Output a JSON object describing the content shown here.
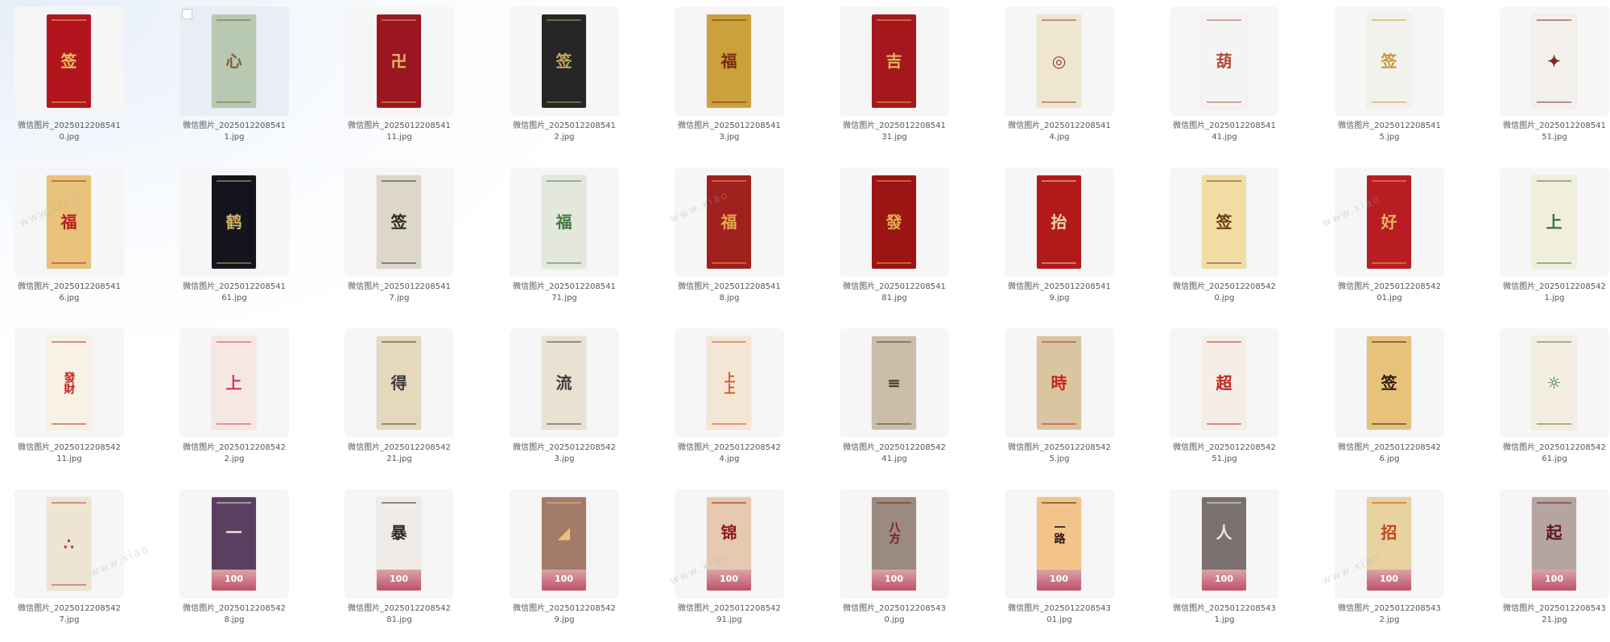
{
  "files": [
    {
      "name": "微信图片_20250122085410.jpg",
      "theme": {
        "bg": "#b3151e",
        "fg": "#e8c060",
        "motif": "签"
      }
    },
    {
      "name": "微信图片_20250122085411.jpg",
      "theme": {
        "bg": "#b7c9b0",
        "fg": "#8a5a3a",
        "motif": "心"
      },
      "selected": true
    },
    {
      "name": "微信图片_202501220854111.jpg",
      "theme": {
        "bg": "#9b1620",
        "fg": "#e0b86a",
        "motif": "卍"
      }
    },
    {
      "name": "微信图片_20250122085412.jpg",
      "theme": {
        "bg": "#262626",
        "fg": "#c8a85a",
        "motif": "签"
      }
    },
    {
      "name": "微信图片_20250122085413.jpg",
      "theme": {
        "bg": "#caa13a",
        "fg": "#7a2a10",
        "motif": "福"
      }
    },
    {
      "name": "微信图片_202501220854131.jpg",
      "theme": {
        "bg": "#a5171c",
        "fg": "#e6b660",
        "motif": "吉"
      }
    },
    {
      "name": "微信图片_20250122085414.jpg",
      "theme": {
        "bg": "#efe6d2",
        "fg": "#9a3a2a",
        "motif": "◎"
      }
    },
    {
      "name": "微信图片_202501220854141.jpg",
      "theme": {
        "bg": "#f4f4f4",
        "fg": "#b24a3a",
        "motif": "葫"
      }
    },
    {
      "name": "微信图片_20250122085415.jpg",
      "theme": {
        "bg": "#f2f2ec",
        "fg": "#c59a3a",
        "motif": "签"
      }
    },
    {
      "name": "微信图片_202501220854151.jpg",
      "theme": {
        "bg": "#f3efeb",
        "fg": "#7a2a2a",
        "motif": "✦"
      }
    },
    {
      "name": "微信图片_20250122085416.jpg",
      "theme": {
        "bg": "#e8c27a",
        "fg": "#b01e1e",
        "motif": "福"
      }
    },
    {
      "name": "微信图片_202501220854161.jpg",
      "theme": {
        "bg": "#14141c",
        "fg": "#d6b265",
        "motif": "鹤"
      }
    },
    {
      "name": "微信图片_20250122085417.jpg",
      "theme": {
        "bg": "#ddd7c9",
        "fg": "#2a2a2a",
        "motif": "签"
      }
    },
    {
      "name": "微信图片_202501220854171.jpg",
      "theme": {
        "bg": "#e4e8dc",
        "fg": "#3f7a3f",
        "motif": "福"
      }
    },
    {
      "name": "微信图片_20250122085418.jpg",
      "theme": {
        "bg": "#a0201e",
        "fg": "#e2ad4a",
        "motif": "福"
      }
    },
    {
      "name": "微信图片_202501220854181.jpg",
      "theme": {
        "bg": "#9c1414",
        "fg": "#e2b04f",
        "motif": "發"
      }
    },
    {
      "name": "微信图片_20250122085419.jpg",
      "theme": {
        "bg": "#b2191b",
        "fg": "#f1d7a0",
        "motif": "抬"
      }
    },
    {
      "name": "微信图片_20250122085420.jpg",
      "theme": {
        "bg": "#f1dca4",
        "fg": "#6a3a10",
        "motif": "签"
      }
    },
    {
      "name": "微信图片_202501220854201.jpg",
      "theme": {
        "bg": "#b71d23",
        "fg": "#e8b460",
        "motif": "好"
      }
    },
    {
      "name": "微信图片_20250122085421.jpg",
      "theme": {
        "bg": "#f2eedc",
        "fg": "#2f7a3a",
        "motif": "上"
      }
    },
    {
      "name": "微信图片_202501220854211.jpg",
      "theme": {
        "bg": "#f7f1e6",
        "fg": "#c4231e",
        "motif": "發財"
      }
    },
    {
      "name": "微信图片_20250122085422.jpg",
      "theme": {
        "bg": "#f6e7e2",
        "fg": "#d63a5a",
        "motif": "上"
      }
    },
    {
      "name": "微信图片_202501220854221.jpg",
      "theme": {
        "bg": "#e6d8bc",
        "fg": "#3a3a3a",
        "motif": "得"
      }
    },
    {
      "name": "微信图片_20250122085423.jpg",
      "theme": {
        "bg": "#e9e1d2",
        "fg": "#3a3a3a",
        "motif": "流"
      }
    },
    {
      "name": "微信图片_20250122085424.jpg",
      "theme": {
        "bg": "#f4e6d4",
        "fg": "#d2461e",
        "motif": "上上"
      }
    },
    {
      "name": "微信图片_202501220854241.jpg",
      "theme": {
        "bg": "#cbbda8",
        "fg": "#4a3a2a",
        "motif": "≡"
      }
    },
    {
      "name": "微信图片_20250122085425.jpg",
      "theme": {
        "bg": "#d9c6a0",
        "fg": "#c4281e",
        "motif": "時"
      }
    },
    {
      "name": "微信图片_202501220854251.jpg",
      "theme": {
        "bg": "#f6eee6",
        "fg": "#c4231e",
        "motif": "超"
      }
    },
    {
      "name": "微信图片_20250122085426.jpg",
      "theme": {
        "bg": "#e6c27a",
        "fg": "#2a1a10",
        "motif": "签"
      }
    },
    {
      "name": "微信图片_202501220854261.jpg",
      "theme": {
        "bg": "#f4eee2",
        "fg": "#3a7a3a",
        "motif": "☼"
      }
    },
    {
      "name": "微信图片_20250122085427.jpg",
      "theme": {
        "bg": "#eee4d2",
        "fg": "#b03a3a",
        "motif": "∴"
      }
    },
    {
      "name": "微信图片_20250122085428.jpg",
      "theme": {
        "bg": "#5a4060",
        "fg": "#f0e6d2",
        "motif": "一"
      },
      "bill": true
    },
    {
      "name": "微信图片_202501220854281.jpg",
      "theme": {
        "bg": "#f0ebe6",
        "fg": "#2a2a2a",
        "motif": "暴"
      },
      "bill": true
    },
    {
      "name": "微信图片_20250122085429.jpg",
      "theme": {
        "bg": "#a47a6a",
        "fg": "#e6c27a",
        "motif": "◢"
      },
      "bill": true
    },
    {
      "name": "微信图片_202501220854291.jpg",
      "theme": {
        "bg": "#e6cab0",
        "fg": "#8a1a1a",
        "motif": "锦"
      },
      "bill": true
    },
    {
      "name": "微信图片_20250122085430.jpg",
      "theme": {
        "bg": "#9a8a80",
        "fg": "#7a1a1a",
        "motif": "八方"
      },
      "bill": true
    },
    {
      "name": "微信图片_202501220854301.jpg",
      "theme": {
        "bg": "#f3c48a",
        "fg": "#2a1a10",
        "motif": "一路"
      },
      "bill": true
    },
    {
      "name": "微信图片_20250122085431.jpg",
      "theme": {
        "bg": "#7a7070",
        "fg": "#f0e6d2",
        "motif": "人"
      },
      "bill": true
    },
    {
      "name": "微信图片_20250122085432.jpg",
      "theme": {
        "bg": "#e8d2a0",
        "fg": "#c4461e",
        "motif": "招"
      },
      "bill": true
    },
    {
      "name": "微信图片_202501220854321.jpg",
      "theme": {
        "bg": "#b5a4a0",
        "fg": "#5a1a1a",
        "motif": "起"
      },
      "bill": true
    }
  ],
  "bill_label": "100",
  "watermark_text": "www.xiao"
}
